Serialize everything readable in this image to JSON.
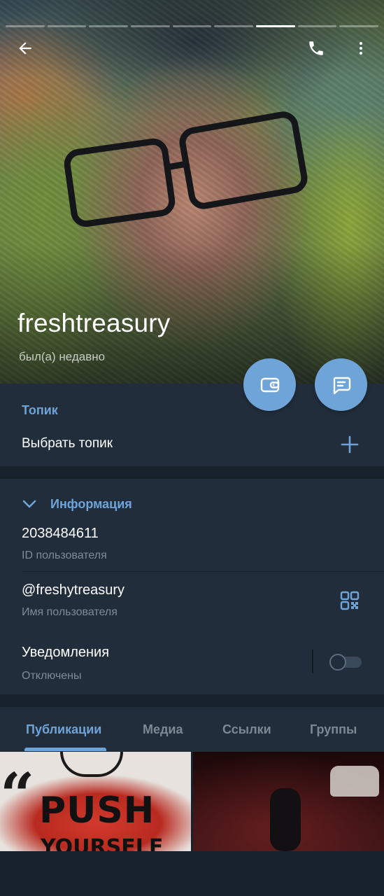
{
  "header": {
    "name": "freshtreasury",
    "status": "был(а) недавно",
    "story_segments": 9,
    "active_segment": 7
  },
  "topic": {
    "title": "Топик",
    "select_label": "Выбрать топик"
  },
  "info": {
    "title": "Информация",
    "user_id": "2038484611",
    "user_id_label": "ID пользователя",
    "username": "@freshytreasury",
    "username_label": "Имя пользователя",
    "notifications": "Уведомления",
    "notifications_state": "Отключены"
  },
  "tabs": [
    {
      "label": "Публикации",
      "active": true
    },
    {
      "label": "Медиа",
      "active": false
    },
    {
      "label": "Ссылки",
      "active": false
    },
    {
      "label": "Группы",
      "active": false
    }
  ],
  "media": {
    "post1_headline": "PUSH",
    "post1_subline": "YOURSELF"
  },
  "colors": {
    "accent": "#6fa4d8",
    "background": "#18222d",
    "surface": "#212d3b",
    "secondary_text": "#7f8b97"
  },
  "icons": [
    "back-arrow-icon",
    "phone-icon",
    "more-vert-icon",
    "wallet-icon",
    "message-icon",
    "plus-icon",
    "chevron-down-icon",
    "qr-code-icon"
  ]
}
